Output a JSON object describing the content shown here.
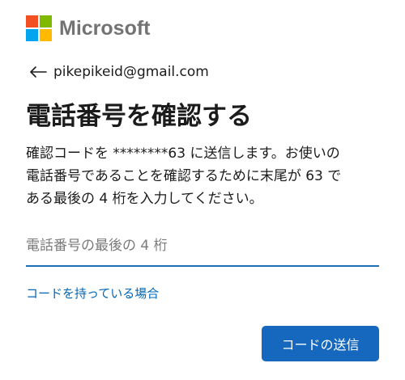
{
  "logo": {
    "text": "Microsoft",
    "squares": [
      "#f25022",
      "#7fba00",
      "#00a4ef",
      "#ffb900"
    ]
  },
  "identity": {
    "back_icon": "back-arrow-icon",
    "email": "pikepikeid@gmail.com"
  },
  "title": "電話番号を確認する",
  "description": {
    "lines": [
      "確認コードを ********63 に送信します。お使いの",
      "電話番号であることを確認するために末尾が 63 で",
      "ある最後の 4 桁を入力してください。"
    ]
  },
  "phone_input": {
    "value": "",
    "placeholder": "電話番号の最後の 4 桁"
  },
  "have_code_link": "コードを持っている場合",
  "send_code_button": "コードの送信",
  "colors": {
    "accent": "#1568bd",
    "link": "#0067b8",
    "input_underline": "#1f6fb5"
  }
}
